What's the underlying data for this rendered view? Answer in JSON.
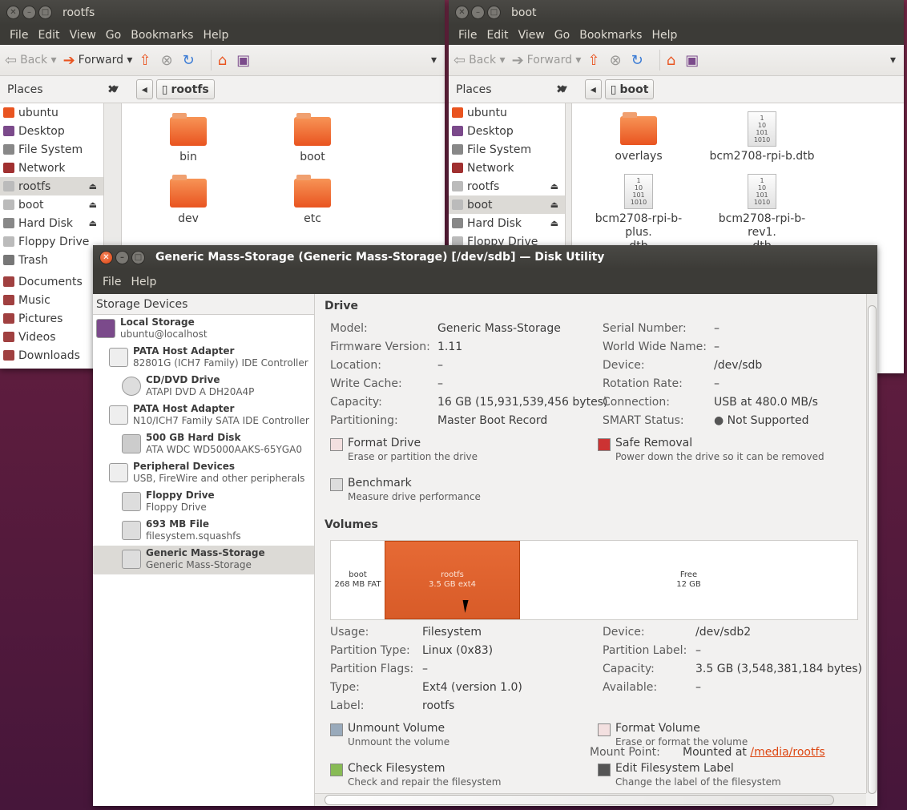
{
  "win_rootfs": {
    "title": "rootfs",
    "menu": [
      "File",
      "Edit",
      "View",
      "Go",
      "Bookmarks",
      "Help"
    ],
    "back": "Back",
    "forward": "Forward",
    "places_label": "Places",
    "path": "rootfs",
    "places": [
      {
        "label": "ubuntu",
        "color": "#e95420"
      },
      {
        "label": "Desktop",
        "color": "#7b4a8b"
      },
      {
        "label": "File System",
        "color": "#888"
      },
      {
        "label": "Network",
        "color": "#a03030"
      },
      {
        "label": "rootfs",
        "color": "#bbb"
      },
      {
        "label": "boot",
        "color": "#bbb"
      },
      {
        "label": "Hard Disk",
        "color": "#888"
      },
      {
        "label": "Floppy Drive",
        "color": "#bbb"
      },
      {
        "label": "Trash",
        "color": "#777"
      },
      {
        "label": "Documents",
        "color": "#a04040"
      },
      {
        "label": "Music",
        "color": "#a04040"
      },
      {
        "label": "Pictures",
        "color": "#a04040"
      },
      {
        "label": "Videos",
        "color": "#a04040"
      },
      {
        "label": "Downloads",
        "color": "#a04040"
      }
    ],
    "files": [
      "bin",
      "boot",
      "dev",
      "etc"
    ]
  },
  "win_boot": {
    "title": "boot",
    "menu": [
      "File",
      "Edit",
      "View",
      "Go",
      "Bookmarks",
      "Help"
    ],
    "back": "Back",
    "forward": "Forward",
    "places_label": "Places",
    "path": "boot",
    "places": [
      {
        "label": "ubuntu",
        "color": "#e95420"
      },
      {
        "label": "Desktop",
        "color": "#7b4a8b"
      },
      {
        "label": "File System",
        "color": "#888"
      },
      {
        "label": "Network",
        "color": "#a03030"
      },
      {
        "label": "rootfs",
        "color": "#bbb"
      },
      {
        "label": "boot",
        "color": "#bbb"
      },
      {
        "label": "Hard Disk",
        "color": "#888"
      },
      {
        "label": "Floppy Drive",
        "color": "#bbb"
      }
    ],
    "files": [
      "overlays",
      "bcm2708-rpi-b.dtb",
      "bcm2708-rpi-b-plus.\ndtb",
      "bcm2708-rpi-b-rev1.\ndtb"
    ]
  },
  "disk_utility": {
    "title": "Generic Mass-Storage (Generic Mass-Storage) [/dev/sdb] — Disk Utility",
    "menu": [
      "File",
      "Help"
    ],
    "storage_header": "Storage Devices",
    "devices": [
      {
        "t1": "Local Storage",
        "t2": "ubuntu@localhost",
        "indent": 0,
        "icon": "computer"
      },
      {
        "t1": "PATA Host Adapter",
        "t2": "82801G (ICH7 Family) IDE Controller",
        "indent": 16,
        "icon": "adapter"
      },
      {
        "t1": "CD/DVD Drive",
        "t2": "ATAPI DVD A  DH20A4P",
        "indent": 32,
        "icon": "disc"
      },
      {
        "t1": "PATA Host Adapter",
        "t2": "N10/ICH7 Family SATA IDE Controller",
        "indent": 16,
        "icon": "adapter"
      },
      {
        "t1": "500 GB Hard Disk",
        "t2": "ATA WDC WD5000AAKS-65YGA0",
        "indent": 32,
        "icon": "disk"
      },
      {
        "t1": "Peripheral Devices",
        "t2": "USB, FireWire and other peripherals",
        "indent": 16,
        "icon": "usb"
      },
      {
        "t1": "Floppy Drive",
        "t2": "Floppy Drive",
        "indent": 32,
        "icon": "floppy"
      },
      {
        "t1": "693 MB File",
        "t2": "filesystem.squashfs",
        "indent": 32,
        "icon": "file"
      },
      {
        "t1": "Generic Mass-Storage",
        "t2": "Generic Mass-Storage",
        "indent": 32,
        "icon": "usbdrive",
        "selected": true
      }
    ],
    "drive": {
      "heading": "Drive",
      "left": [
        [
          "Model:",
          "Generic Mass-Storage"
        ],
        [
          "Firmware Version:",
          "1.11"
        ],
        [
          "Location:",
          "–"
        ],
        [
          "Write Cache:",
          "–"
        ],
        [
          "Capacity:",
          "16 GB (15,931,539,456 bytes)"
        ],
        [
          "Partitioning:",
          "Master Boot Record"
        ]
      ],
      "right": [
        [
          "Serial Number:",
          "–"
        ],
        [
          "World Wide Name:",
          "–"
        ],
        [
          "Device:",
          "/dev/sdb"
        ],
        [
          "Rotation Rate:",
          "–"
        ],
        [
          "Connection:",
          "USB at 480.0 MB/s"
        ],
        [
          "SMART Status:",
          "Not Supported"
        ]
      ],
      "actions": [
        {
          "title": "Format Drive",
          "desc": "Erase or partition the drive"
        },
        {
          "title": "Safe Removal",
          "desc": "Power down the drive so it can be removed"
        },
        {
          "title": "Benchmark",
          "desc": "Measure drive performance"
        }
      ]
    },
    "volumes": {
      "heading": "Volumes",
      "parts": [
        {
          "name": "boot",
          "size": "268 MB FAT"
        },
        {
          "name": "rootfs",
          "size": "3.5 GB ext4"
        },
        {
          "name": "Free",
          "size": "12 GB"
        }
      ],
      "left": [
        [
          "Usage:",
          "Filesystem"
        ],
        [
          "Partition Type:",
          "Linux (0x83)"
        ],
        [
          "Partition Flags:",
          "–"
        ],
        [
          "Type:",
          "Ext4 (version 1.0)"
        ],
        [
          "Label:",
          "rootfs"
        ]
      ],
      "right": [
        [
          "Device:",
          "/dev/sdb2"
        ],
        [
          "Partition Label:",
          "–"
        ],
        [
          "Capacity:",
          "3.5 GB (3,548,381,184 bytes)"
        ],
        [
          "Available:",
          "–"
        ]
      ],
      "mount_label": "Mount Point:",
      "mount_prefix": "Mounted at ",
      "mount_link": "/media/rootfs",
      "actions": [
        {
          "title": "Unmount Volume",
          "desc": "Unmount the volume"
        },
        {
          "title": "Format Volume",
          "desc": "Erase or format the volume"
        },
        {
          "title": "Check Filesystem",
          "desc": "Check and repair the filesystem"
        },
        {
          "title": "Edit Filesystem Label",
          "desc": "Change the label of the filesystem"
        }
      ]
    }
  }
}
